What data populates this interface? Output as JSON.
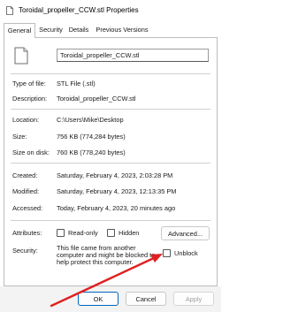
{
  "window": {
    "title": "Toroidal_propeller_CCW.stl Properties"
  },
  "tabs": [
    {
      "label": "General",
      "active": true
    },
    {
      "label": "Security",
      "active": false
    },
    {
      "label": "Details",
      "active": false
    },
    {
      "label": "Previous Versions",
      "active": false
    }
  ],
  "file": {
    "name": "Toroidal_propeller_CCW.stl",
    "icon": "document-icon"
  },
  "props": {
    "type_label": "Type of file:",
    "type_value": "STL File (.stl)",
    "desc_label": "Description:",
    "desc_value": "Toroidal_propeller_CCW.stl",
    "location_label": "Location:",
    "location_value": "C:\\Users\\Mike\\Desktop",
    "size_label": "Size:",
    "size_value": "756 KB (774,284 bytes)",
    "size_disk_label": "Size on disk:",
    "size_disk_value": "760 KB (778,240 bytes)",
    "created_label": "Created:",
    "created_value": "Saturday, February 4, 2023, 2:03:28 PM",
    "modified_label": "Modified:",
    "modified_value": "Saturday, February 4, 2023, 12:13:35 PM",
    "accessed_label": "Accessed:",
    "accessed_value": "Today, February 4, 2023, 20 minutes ago"
  },
  "attributes": {
    "label": "Attributes:",
    "readonly_label": "Read-only",
    "readonly_checked": false,
    "hidden_label": "Hidden",
    "hidden_checked": false,
    "advanced_label": "Advanced..."
  },
  "security": {
    "label": "Security:",
    "text": "This file came from another computer and might be blocked to help protect this computer.",
    "unblock_label": "Unblock",
    "unblock_checked": false
  },
  "buttons": {
    "ok": "OK",
    "cancel": "Cancel",
    "apply": "Apply"
  },
  "colors": {
    "accent": "#0067c0",
    "arrow": "#e02020"
  }
}
